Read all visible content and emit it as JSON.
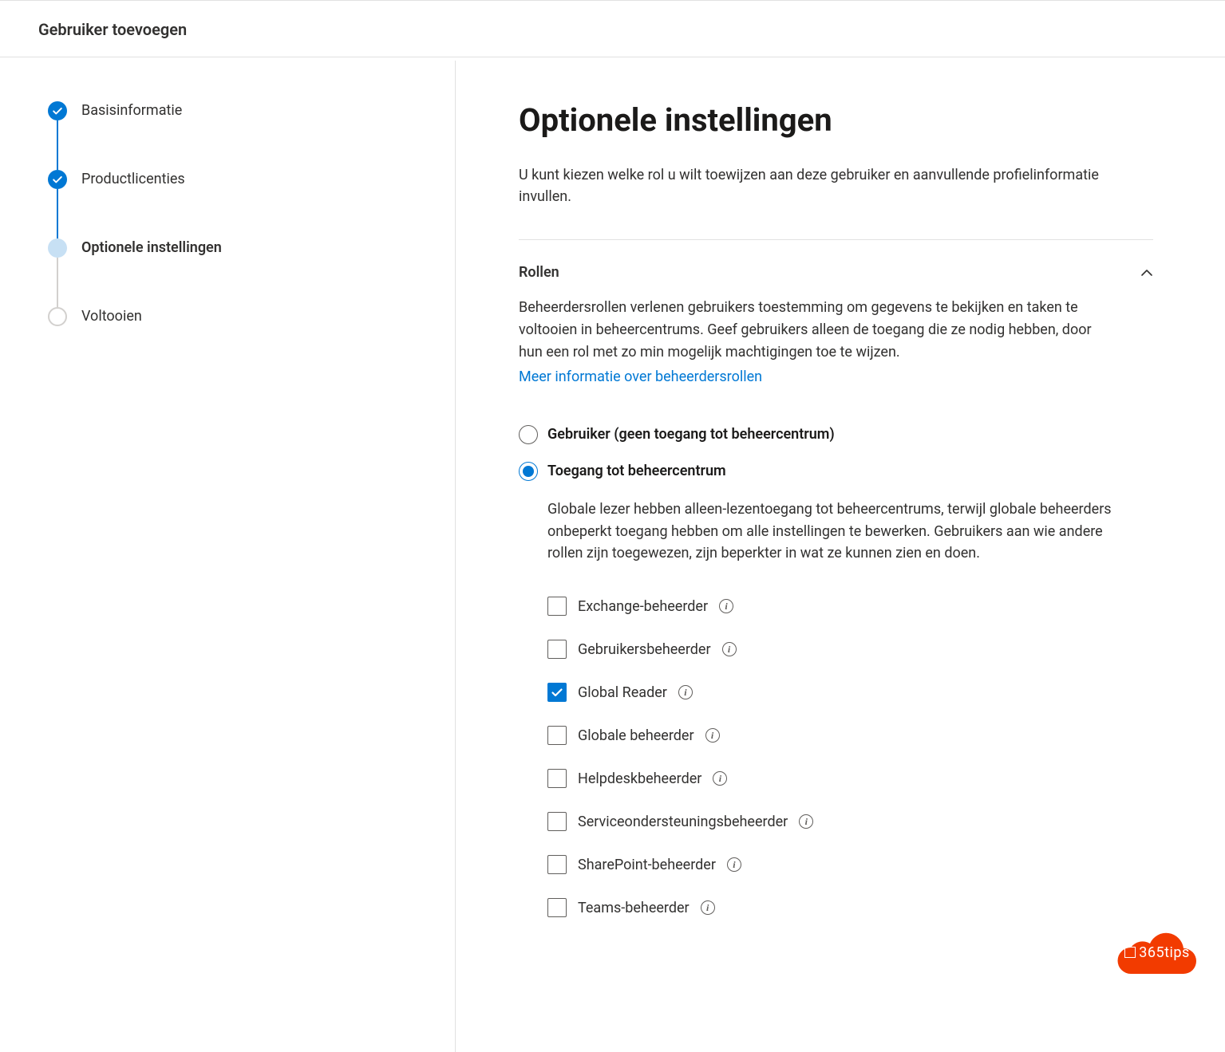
{
  "header": {
    "title": "Gebruiker toevoegen"
  },
  "steps": [
    {
      "label": "Basisinformatie",
      "state": "complete"
    },
    {
      "label": "Productlicenties",
      "state": "complete"
    },
    {
      "label": "Optionele instellingen",
      "state": "current"
    },
    {
      "label": "Voltooien",
      "state": "upcoming"
    }
  ],
  "panel": {
    "title": "Optionele instellingen",
    "description": "U kunt kiezen welke rol u wilt toewijzen aan deze gebruiker en aanvullende profielinformatie invullen."
  },
  "roles": {
    "section_title": "Rollen",
    "description": "Beheerdersrollen verlenen gebruikers toestemming om gegevens te bekijken en taken te voltooien in beheercentrums. Geef gebruikers alleen de toegang die ze nodig hebben, door hun een rol met zo min mogelijk machtigingen toe te wijzen.",
    "learn_more": "Meer informatie over beheerdersrollen",
    "options": [
      {
        "label": "Gebruiker (geen toegang tot beheercentrum)",
        "selected": false
      },
      {
        "label": "Toegang tot beheercentrum",
        "selected": true
      }
    ],
    "admin_access_desc": "Globale lezer hebben alleen-lezentoegang tot beheercentrums, terwijl globale beheerders onbeperkt toegang hebben om alle instellingen te bewerken. Gebruikers aan wie andere rollen zijn toegewezen, zijn beperkter in wat ze kunnen zien en doen.",
    "admin_roles": [
      {
        "label": "Exchange-beheerder",
        "checked": false
      },
      {
        "label": "Gebruikersbeheerder",
        "checked": false
      },
      {
        "label": "Global Reader",
        "checked": true
      },
      {
        "label": "Globale beheerder",
        "checked": false
      },
      {
        "label": "Helpdeskbeheerder",
        "checked": false
      },
      {
        "label": "Serviceondersteuningsbeheerder",
        "checked": false
      },
      {
        "label": "SharePoint-beheerder",
        "checked": false
      },
      {
        "label": "Teams-beheerder",
        "checked": false
      }
    ]
  },
  "badge": {
    "text": "365tips"
  }
}
